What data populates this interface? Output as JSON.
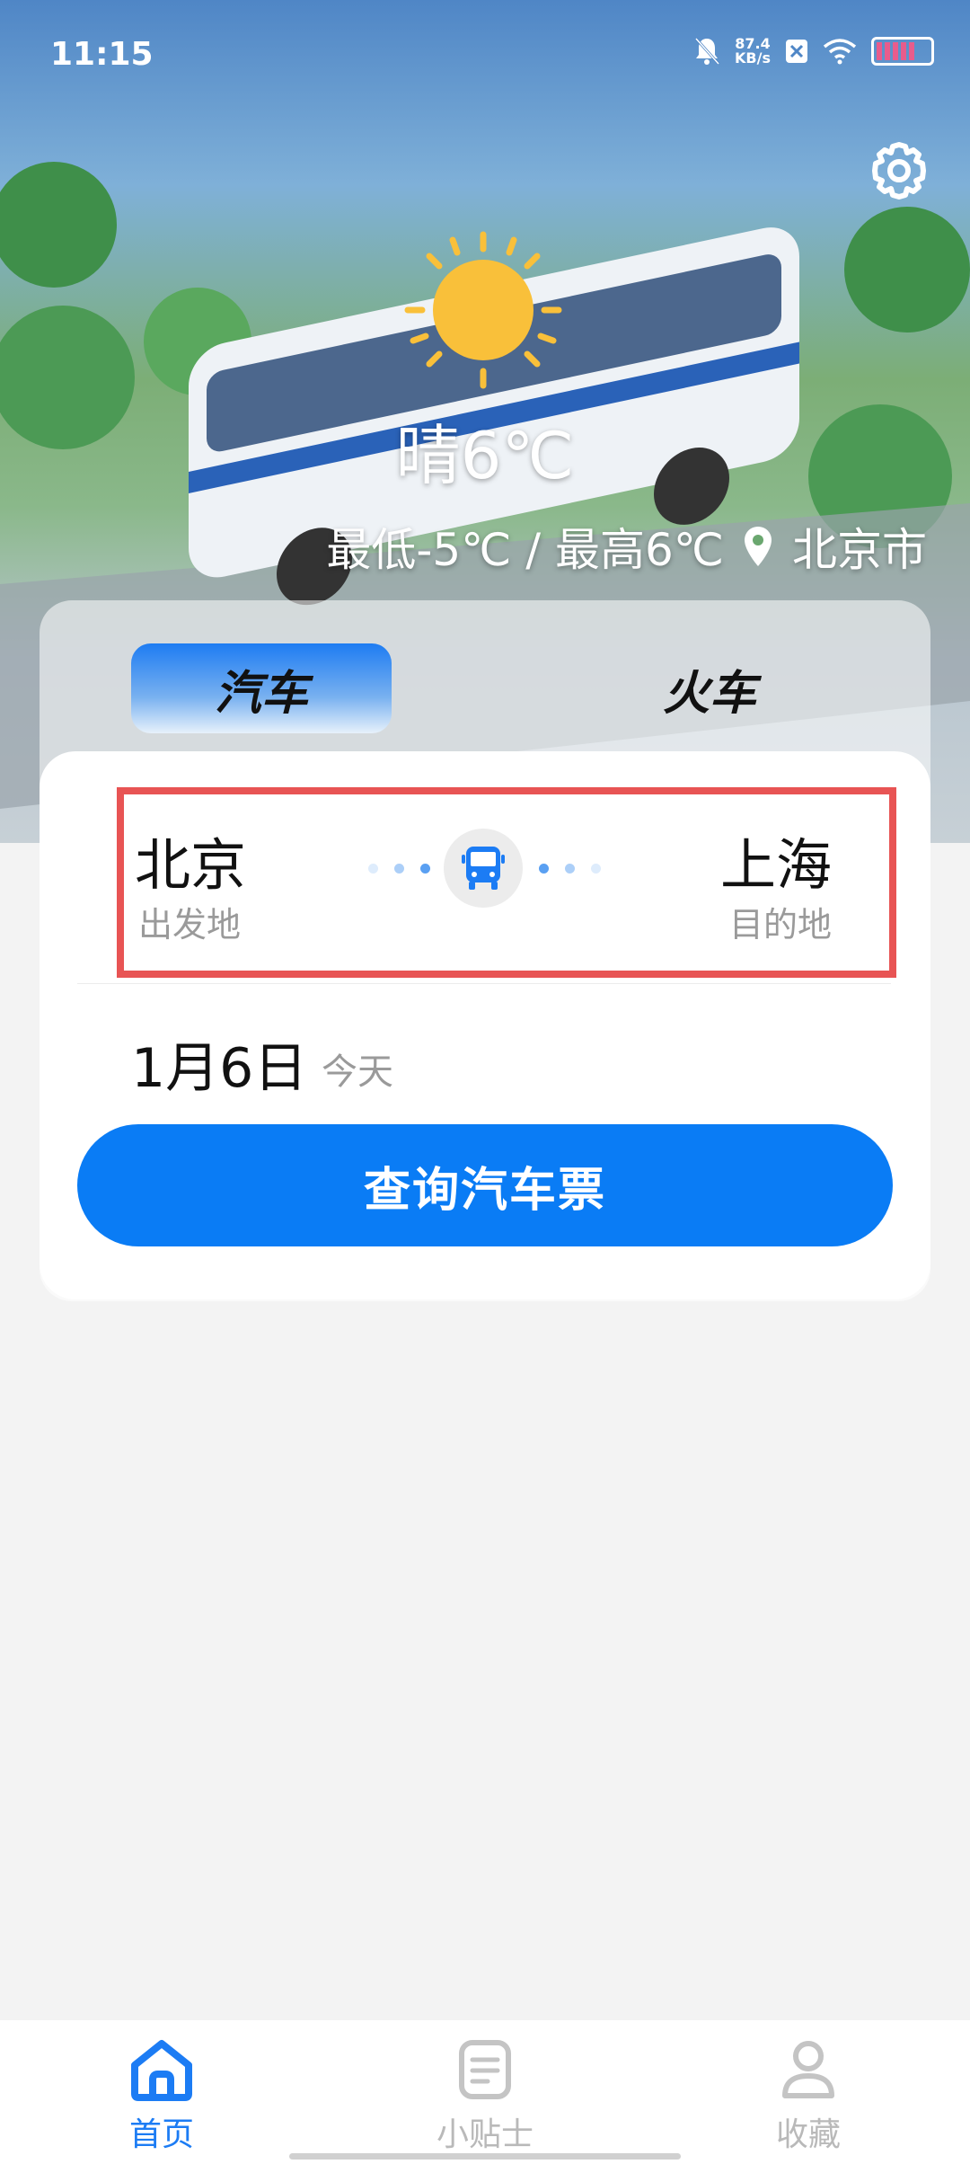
{
  "status_bar": {
    "time": "11:15",
    "net_speed_value": "87.4",
    "net_speed_unit": "KB/s",
    "icons": [
      "bell-off-icon",
      "close-box-icon",
      "wifi-icon",
      "battery-icon"
    ]
  },
  "weather": {
    "temperature": "晴6℃",
    "range": "最低-5℃ / 最高6℃",
    "city": "北京市",
    "icon": "sun-icon"
  },
  "tabs": [
    {
      "label": "汽车",
      "active": true
    },
    {
      "label": "火车",
      "active": false
    }
  ],
  "route": {
    "from_city": "北京",
    "from_label": "出发地",
    "to_city": "上海",
    "to_label": "目的地",
    "swap_icon": "bus-icon"
  },
  "date": {
    "value": "1月6日",
    "label": "今天"
  },
  "search_button": "查询汽车票",
  "bottom_nav": [
    {
      "label": "首页",
      "icon": "home-icon",
      "active": true
    },
    {
      "label": "小贴士",
      "icon": "notes-icon",
      "active": false
    },
    {
      "label": "收藏",
      "icon": "user-icon",
      "active": false
    }
  ],
  "colors": {
    "accent": "#0a7cf5",
    "highlight_border": "#e85454",
    "nav_active": "#1c7cf4",
    "nav_inactive": "#b9b9b9"
  }
}
